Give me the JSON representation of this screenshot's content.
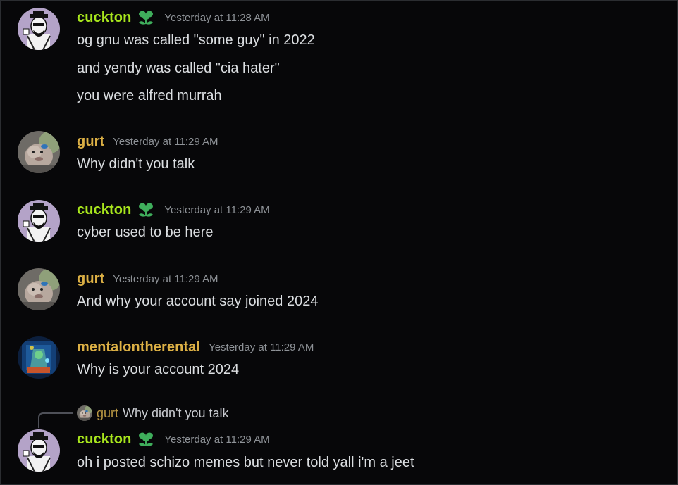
{
  "colors": {
    "background": "#070709",
    "cuckton_name": "#a8e61d",
    "gold_name": "#dcb045",
    "timestamp": "#8e9297",
    "text": "#dbdee1",
    "badge": "#3fae5c"
  },
  "messages": [
    {
      "author": "cuckton",
      "timestamp": "Yesterday at 11:28 AM",
      "badge_icon": "green-flower-icon",
      "lines": [
        "og gnu was called \"some guy\" in 2022",
        "and yendy was called \"cia hater\"",
        "you were alfred murrah"
      ]
    },
    {
      "author": "gurt",
      "timestamp": "Yesterday at 11:29 AM",
      "lines": [
        "Why didn't you talk"
      ]
    },
    {
      "author": "cuckton",
      "timestamp": "Yesterday at 11:29 AM",
      "badge_icon": "green-flower-icon",
      "lines": [
        "cyber used to be here"
      ]
    },
    {
      "author": "gurt",
      "timestamp": "Yesterday at 11:29 AM",
      "lines": [
        "And why your account say joined 2024"
      ]
    },
    {
      "author": "mentalontherental",
      "timestamp": "Yesterday at 11:29 AM",
      "lines": [
        "Why is your account 2024"
      ]
    },
    {
      "author": "cuckton",
      "timestamp": "Yesterday at 11:29 AM",
      "badge_icon": "green-flower-icon",
      "reply_to": {
        "author": "gurt",
        "text": "Why didn't you talk"
      },
      "lines": [
        "oh i posted schizo memes but never told yall i'm a jeet"
      ]
    }
  ]
}
